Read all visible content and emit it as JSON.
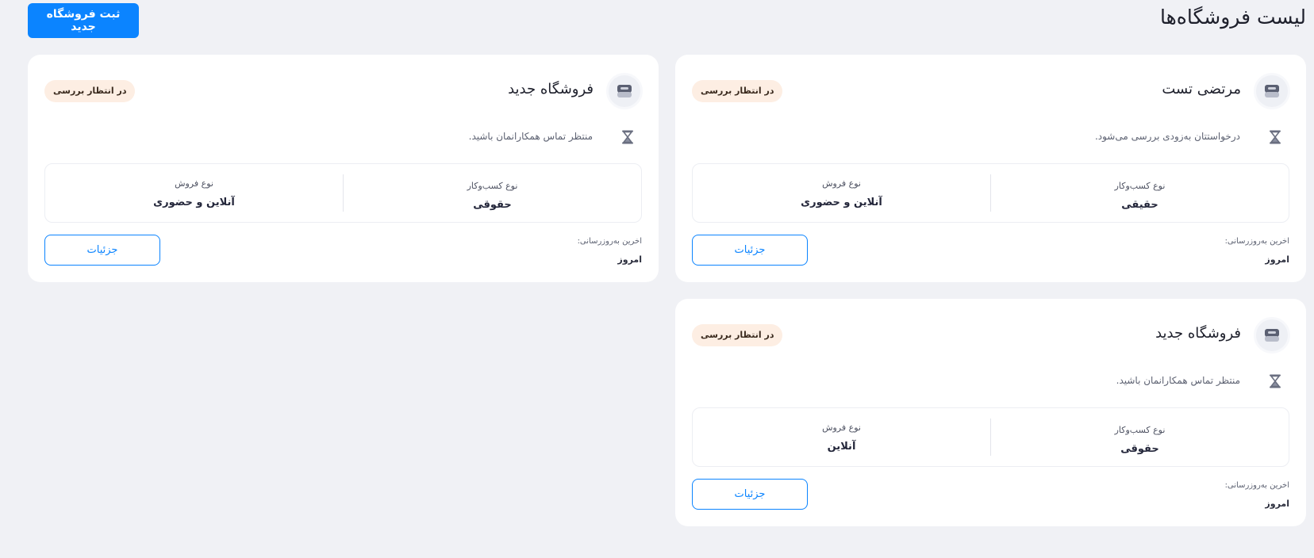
{
  "header": {
    "title": "لیست فروشگاه‌ها",
    "new_store_label": "ثبت فروشگاه جدید"
  },
  "stores": [
    {
      "name": "مرتضی تست",
      "status": "در انتظار بررسی",
      "message": "درخواستتان به‌زودی بررسی می‌شود.",
      "business_type_label": "نوع کسب‌وکار",
      "business_type": "حقیقی",
      "sales_type_label": "نوع فروش",
      "sales_type": "آنلاین و حضوری",
      "updated_label": "اخرین به‌روزرسانی:",
      "updated": "امروز",
      "details_label": "جزئیات"
    },
    {
      "name": "فروشگاه جدید",
      "status": "در انتظار بررسی",
      "message": "منتظر تماس همکارانمان باشید.",
      "business_type_label": "نوع کسب‌وکار",
      "business_type": "حقوقی",
      "sales_type_label": "نوع فروش",
      "sales_type": "آنلاین و حضوری",
      "updated_label": "اخرین به‌روزرسانی:",
      "updated": "امروز",
      "details_label": "جزئیات"
    },
    {
      "name": "فروشگاه جدید",
      "status": "در انتظار بررسی",
      "message": "منتظر تماس همکارانمان باشید.",
      "business_type_label": "نوع کسب‌وکار",
      "business_type": "حقوقی",
      "sales_type_label": "نوع فروش",
      "sales_type": "آنلاین",
      "updated_label": "اخرین به‌روزرسانی:",
      "updated": "امروز",
      "details_label": "جزئیات"
    }
  ],
  "icons": {
    "avatar": "store-avatar-icon",
    "status": "hourglass-icon"
  },
  "colors": {
    "accent": "#0b84ff",
    "badge_bg": "#fdeee3",
    "page_bg": "#f0f1f5"
  }
}
